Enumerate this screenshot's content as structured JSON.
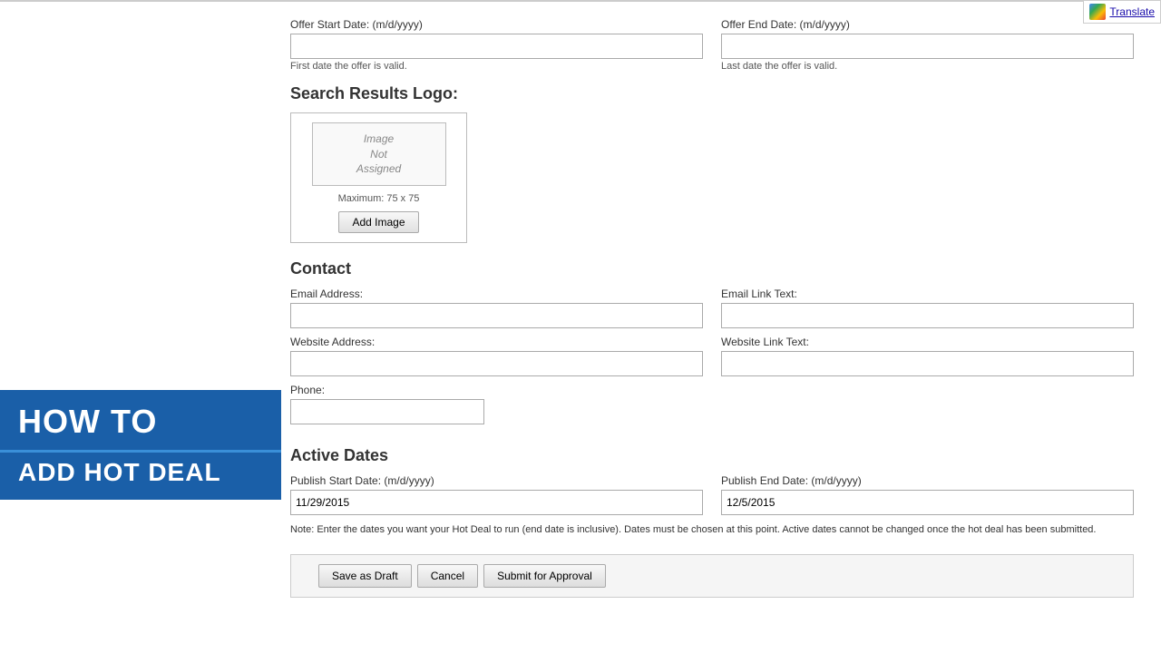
{
  "translate_button": {
    "label": "Translate"
  },
  "overlay": {
    "line1": "HOW TO",
    "line2": "ADD HOT DEAL"
  },
  "offer_dates": {
    "start_label": "Offer Start Date: (m/d/yyyy)",
    "start_hint": "First date the offer is valid.",
    "start_value": "",
    "end_label": "Offer End Date: (m/d/yyyy)",
    "end_hint": "Last date the offer is valid.",
    "end_value": ""
  },
  "logo_section": {
    "title": "Search Results Logo:",
    "image_placeholder_line1": "Image",
    "image_placeholder_line2": "Not",
    "image_placeholder_line3": "Assigned",
    "max_size": "Maximum: 75 x 75",
    "add_image_btn": "Add Image"
  },
  "contact": {
    "title": "Contact",
    "email_address_label": "Email Address:",
    "email_address_value": "",
    "email_link_text_label": "Email Link Text:",
    "email_link_text_value": "",
    "website_address_label": "Website Address:",
    "website_address_value": "",
    "website_link_text_label": "Website Link Text:",
    "website_link_text_value": "",
    "phone_label": "Phone:",
    "phone_value": ""
  },
  "active_dates": {
    "title": "Active Dates",
    "publish_start_label": "Publish Start Date: (m/d/yyyy)",
    "publish_start_value": "11/29/2015",
    "publish_end_label": "Publish End Date: (m/d/yyyy)",
    "publish_end_value": "12/5/2015",
    "note": "Note: Enter the dates you want your Hot Deal to run (end date is inclusive). Dates must be chosen at this point. Active dates cannot be changed once the hot deal has been submitted."
  },
  "actions": {
    "save_draft": "Save as Draft",
    "cancel": "Cancel",
    "submit": "Submit for Approval"
  }
}
